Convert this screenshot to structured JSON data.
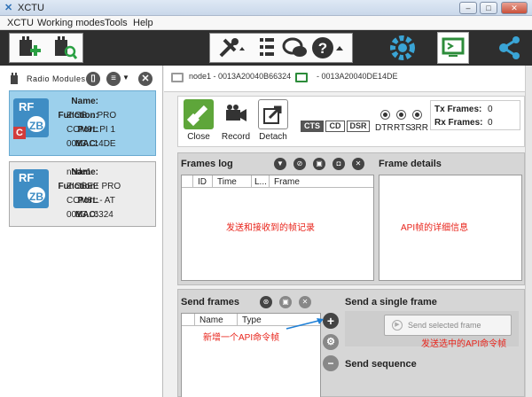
{
  "window": {
    "title": "XCTU",
    "minimize": "–",
    "maximize": "□",
    "close": "✕"
  },
  "menu": [
    "XCTU",
    "Working modes",
    "Tools",
    "Help"
  ],
  "left_panel": {
    "title": "Radio Modules",
    "modules": [
      {
        "name_label": "Name:",
        "name": "",
        "function_label": "Function:",
        "function": "ZIGB... PRO",
        "port_label": "Port:",
        "port": "COM9...PI 1",
        "mac_label": "MAC:",
        "mac": "0013...14DE",
        "badge": "C",
        "icon_top": "RF",
        "icon_bottom": "ZB"
      },
      {
        "name_label": "Name:",
        "name": "node1",
        "function_label": "Function:",
        "function": "ZIGBEE PRO",
        "port_label": "Port:",
        "port": "COM8...- AT",
        "mac_label": "MAC:",
        "mac": "0013...6324",
        "icon_top": "RF",
        "icon_bottom": "ZB"
      }
    ]
  },
  "connections": [
    {
      "label": "node1 - 0013A20040B66324"
    },
    {
      "label": "- 0013A20040DE14DE"
    }
  ],
  "actions": {
    "close": "Close",
    "record": "Record",
    "detach": "Detach"
  },
  "flags": [
    "CTS",
    "CD",
    "DSR"
  ],
  "lines": [
    "DTR",
    "RTS",
    "3RR"
  ],
  "frames": {
    "tx_label": "Tx Frames:",
    "tx": "0",
    "rx_label": "Rx Frames:",
    "rx": "0"
  },
  "frames_log": {
    "title": "Frames log",
    "columns": [
      "ID",
      "Time",
      "L...",
      "Frame"
    ],
    "note": "发送和接收到的帧记录",
    "details_title": "Frame details",
    "details_note": "API帧的详细信息"
  },
  "send_frames": {
    "title": "Send frames",
    "columns": [
      "Name",
      "Type"
    ],
    "add_note": "新增一个API命令帧",
    "single_title": "Send a single frame",
    "send_selected": "Send selected frame",
    "send_note": "发送选中的API命令帧",
    "sequence_title": "Send sequence"
  }
}
